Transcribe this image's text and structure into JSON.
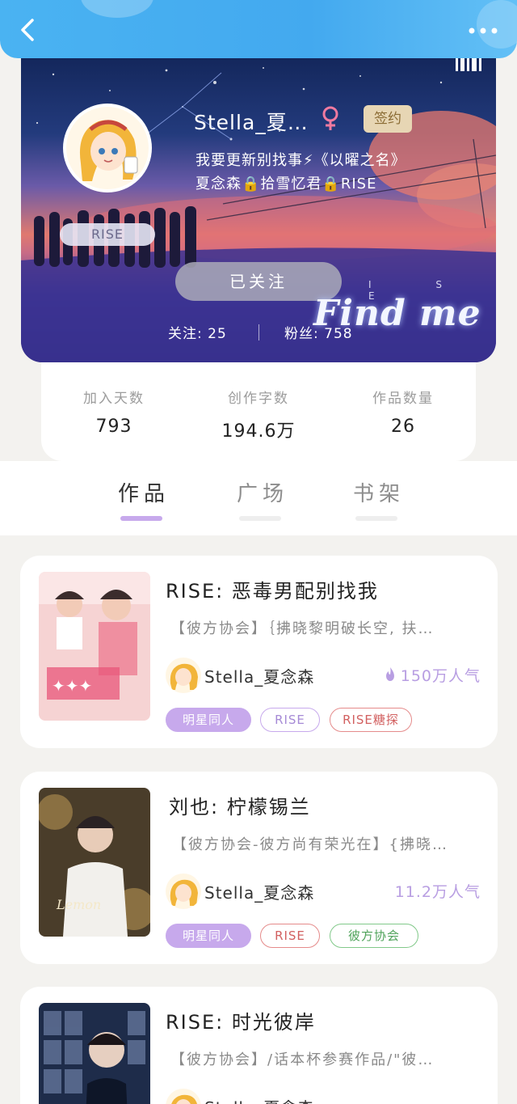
{
  "profile": {
    "username": "Stella_夏…",
    "gender_symbol": "♀",
    "sign_badge": "签约",
    "bio_line1": "我要更新别找事⚡《以曜之名》",
    "bio_line2": "夏念森🔒拾雪忆君🔒RISE",
    "group_tag": "RISE",
    "follow_button": "已关注",
    "banner_letters": "I S E",
    "following_text": "关注: 25",
    "fans_text": "粉丝: 758",
    "overlay_text": "Find me"
  },
  "stats": [
    {
      "label": "加入天数",
      "value": "793"
    },
    {
      "label": "创作字数",
      "value": "194.6万"
    },
    {
      "label": "作品数量",
      "value": "26"
    }
  ],
  "tabs": [
    {
      "label": "作品",
      "active": true
    },
    {
      "label": "广场",
      "active": false
    },
    {
      "label": "书架",
      "active": false
    }
  ],
  "works": [
    {
      "title": "RISE: 恶毒男配别找我",
      "desc": "【彼方协会】｛拂晓黎明破长空, 扶…",
      "author": "Stella_夏念森",
      "popularity": "150万人气",
      "tags": [
        {
          "label": "明星同人",
          "style": "filled"
        },
        {
          "label": "RISE",
          "style": "purple"
        },
        {
          "label": "RISE糖探",
          "style": "red"
        }
      ]
    },
    {
      "title": "刘也: 柠檬锡兰",
      "desc": "【彼方协会-彼方尚有荣光在】{拂晓…",
      "author": "Stella_夏念森",
      "popularity": "11.2万人气",
      "tags": [
        {
          "label": "明星同人",
          "style": "filled"
        },
        {
          "label": "RISE",
          "style": "red"
        },
        {
          "label": "彼方协会",
          "style": "green"
        }
      ]
    },
    {
      "title": "RISE: 时光彼岸",
      "desc": "【彼方协会】/话本杯参赛作品/\"彼…",
      "author": "Stella_夏念森",
      "popularity": "",
      "tags": []
    }
  ],
  "colors": {
    "topbar": "#4ab3f2",
    "accent_purple": "#c7a9ec",
    "tag_red": "#e58b8b",
    "tag_green": "#82c98a",
    "sign_badge": "#e7d6b4"
  },
  "icons": {
    "back": "back-arrow-icon",
    "more": "more-dots-icon",
    "gender": "female-icon",
    "fire": "fire-icon"
  }
}
